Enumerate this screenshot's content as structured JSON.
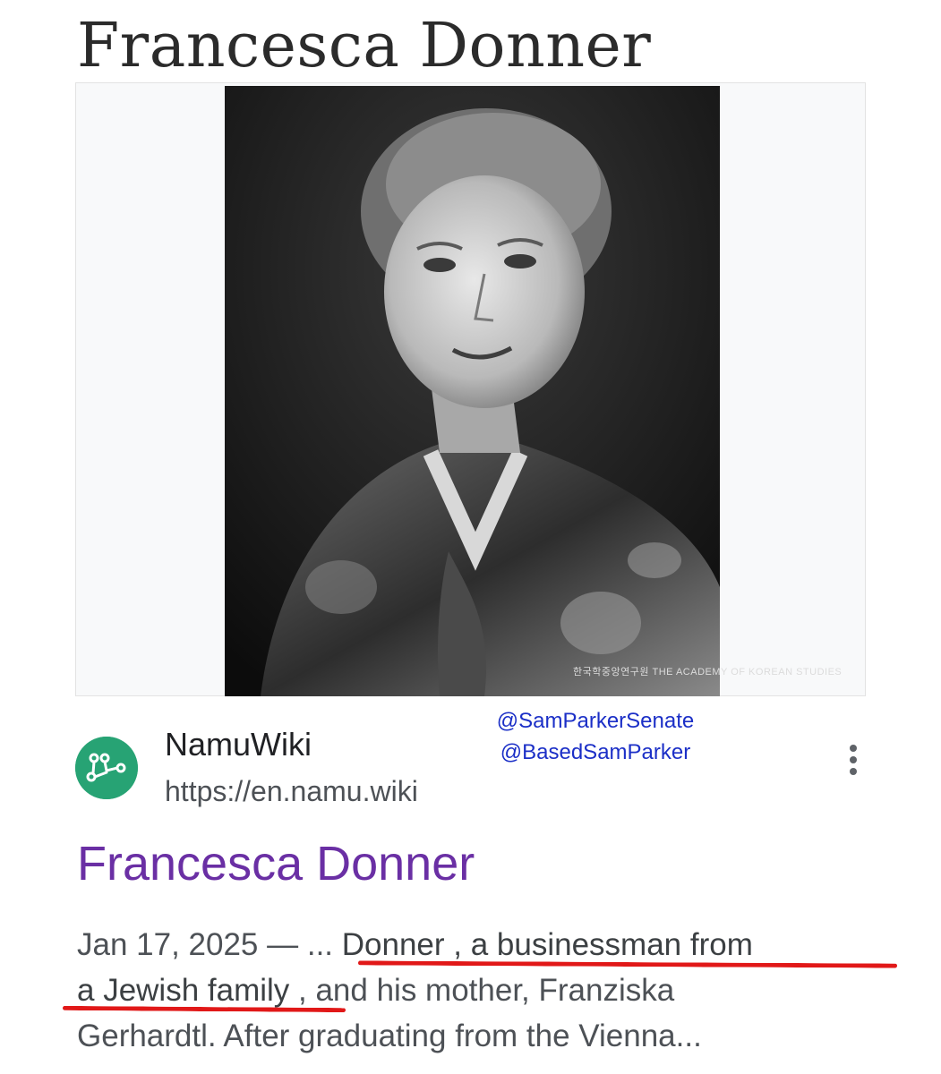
{
  "page": {
    "title": "Francesca Donner"
  },
  "image": {
    "watermark": "한국학중앙연구원 THE ACADEMY OF KOREAN STUDIES"
  },
  "overlay": {
    "handles": [
      "@SamParkerSenate",
      "@BasedSamParker"
    ]
  },
  "result": {
    "site_name": "NamuWiki",
    "site_url": "https://en.namu.wiki",
    "title": "Francesca Donner",
    "snippet": {
      "line1_date": "Jan 17, 2025 — ... ",
      "line1_highlight": "Donner , a businessman from",
      "line2_highlight": "a Jewish family",
      "line2_rest": " , and his mother, Franziska",
      "line3": "Gerhardtl. After graduating from the Vienna..."
    },
    "icons": {
      "site": "namuwiki-logo-icon",
      "more": "more-vertical-icon"
    }
  },
  "colors": {
    "result_title": "#6a2fa4",
    "handles": "#1b2fc7",
    "underline": "#e11818",
    "site_icon_bg": "#27a374"
  }
}
